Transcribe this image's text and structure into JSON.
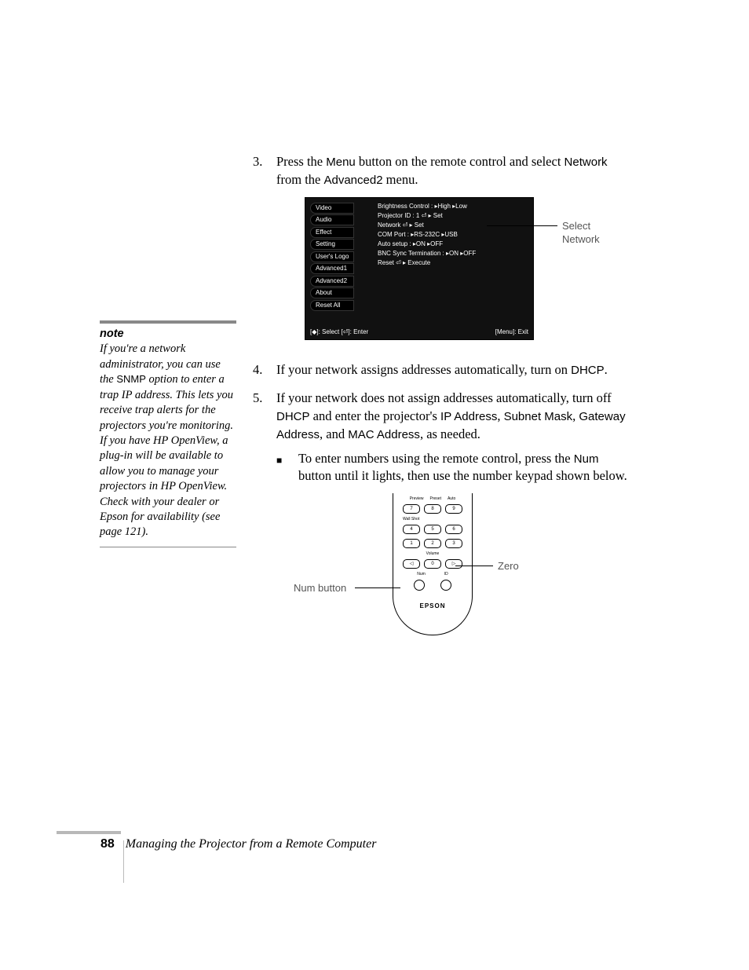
{
  "steps": {
    "s3": {
      "num": "3.",
      "text_a": "Press the ",
      "menu": "Menu",
      "text_b": " button on the remote control and select ",
      "network": "Network",
      "text_c": " from the ",
      "adv2": "Advanced2",
      "text_d": " menu."
    },
    "s4": {
      "num": "4.",
      "text_a": "If your network assigns addresses automatically, turn on ",
      "dhcp": "DHCP",
      "text_b": "."
    },
    "s5": {
      "num": "5.",
      "text_a": "If your network does not assign addresses automatically, turn off ",
      "dhcp": "DHCP",
      "text_b": " and enter the projector's ",
      "ip": "IP Address",
      "c1": ", ",
      "sm": "Subnet Mask",
      "c2": ", ",
      "gw": "Gateway Address",
      "c3": ", and ",
      "mac": "MAC Address",
      "text_c": ", as needed."
    },
    "bullet": {
      "square": "■",
      "text_a": "To enter numbers using the remote control, press the ",
      "num_btn": "Num",
      "text_b": " button until it lights, then use the number keypad shown below."
    }
  },
  "note": {
    "head": "note",
    "pre": "If you're a network administrator, you can use the ",
    "snmp": "SNMP",
    "post": " option to enter a trap IP address. This lets you receive trap alerts for the projectors you're monitoring. If you have HP OpenView, a plug-in will be available to allow you to manage your projectors in HP OpenView. Check with your dealer or Epson for availability (see page 121)."
  },
  "osd": {
    "menu": [
      "Video",
      "Audio",
      "Effect",
      "Setting",
      "User's Logo",
      "Advanced1",
      "Advanced2",
      "About",
      "Reset All"
    ],
    "right": [
      "Brightness Control : ▸High  ▸Low",
      "Projector ID        : 1  ⏎ ▸ Set",
      "Network             ⏎ ▸ Set",
      "COM Port           : ▸RS-232C  ▸USB",
      "Auto setup          : ▸ON ▸OFF",
      "BNC Sync Termination  : ▸ON ▸OFF",
      "Reset               ⏎ ▸ Execute"
    ],
    "footer_left": "[◆]: Select   [⏎]: Enter",
    "footer_right": "[Menu]: Exit",
    "callout": "Select Network"
  },
  "remote": {
    "row1_labels": [
      "Preview",
      "Preset",
      "Auto"
    ],
    "row1": [
      "7",
      "8",
      "9"
    ],
    "wallshot": "Wall Shot",
    "row2": [
      "4",
      "5",
      "6"
    ],
    "row3": [
      "1",
      "2",
      "3"
    ],
    "volume": "Volume",
    "vol_row": [
      "◁",
      "0",
      "▷"
    ],
    "bottom_labels": [
      "Num",
      "ID"
    ],
    "brand": "EPSON",
    "callout_num": "Num button",
    "callout_zero": "Zero"
  },
  "footer": {
    "page": "88",
    "chapter": "Managing the Projector from a Remote Computer"
  }
}
